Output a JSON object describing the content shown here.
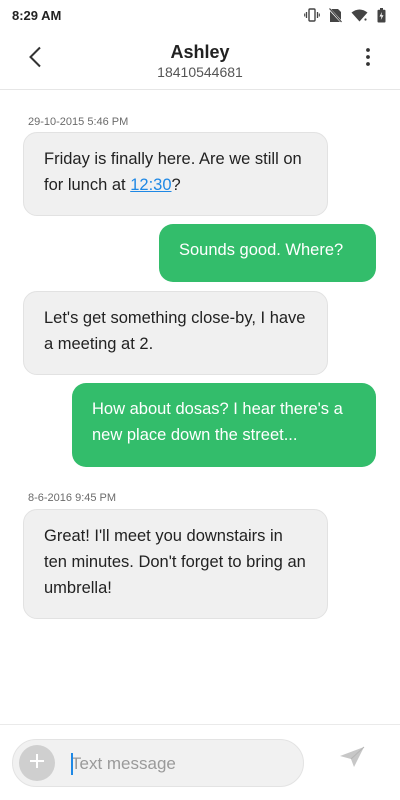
{
  "status_bar": {
    "time": "8:29 AM",
    "icons": [
      "vibrate-icon",
      "no-sim-icon",
      "wifi-icon",
      "battery-icon"
    ]
  },
  "header": {
    "contact_name": "Ashley",
    "contact_number": "18410544681",
    "back_icon": "back-arrow-icon",
    "more_icon": "more-vert-icon"
  },
  "messages": [
    {
      "timestamp": "29-10-2015 5:46 PM"
    },
    {
      "direction": "in",
      "text_before": "Friday is finally here. Are we still on for lunch at ",
      "link": "12:30",
      "text_after": "?"
    },
    {
      "direction": "out",
      "text": "Sounds good. Where?"
    },
    {
      "direction": "in",
      "text": "Let's get something close-by, I have a meeting at 2."
    },
    {
      "direction": "out",
      "text": "How about dosas? I hear there's a new place down the street..."
    },
    {
      "timestamp": "8-6-2016 9:45 PM"
    },
    {
      "direction": "in",
      "text": "Great! I'll meet you downstairs in ten minutes. Don't forget to bring an umbrella!"
    }
  ],
  "composer": {
    "placeholder": "Text message",
    "value": "",
    "add_icon": "plus-icon",
    "send_icon": "send-icon"
  },
  "colors": {
    "incoming_bubble": "#f0f0f0",
    "outgoing_bubble": "#33bd6b",
    "link": "#1e88e5"
  }
}
